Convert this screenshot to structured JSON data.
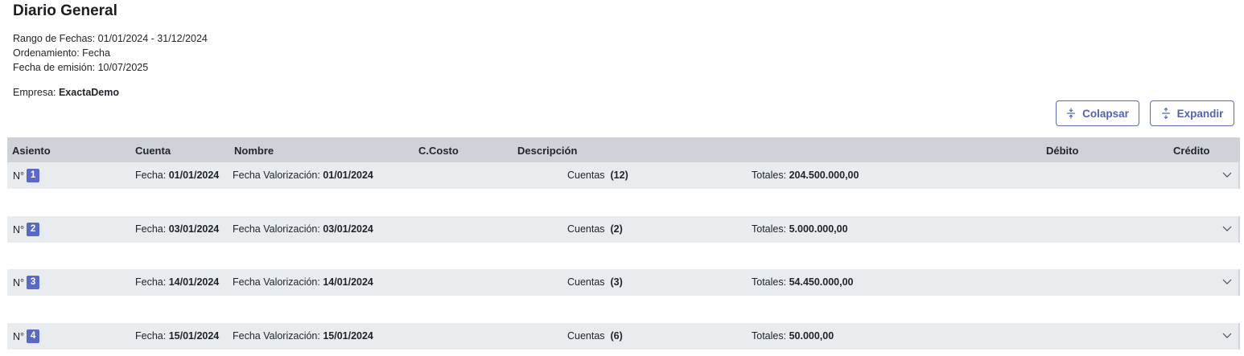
{
  "title": "Diario General",
  "meta": {
    "rango": "Rango de Fechas: 01/01/2024 - 31/12/2024",
    "orden": "Ordenamiento: Fecha",
    "emision": "Fecha de emisión: 10/07/2025",
    "empresa_label": "Empresa: ",
    "empresa_value": "ExactaDemo"
  },
  "buttons": {
    "collapse": "Colapsar",
    "expand": "Expandir"
  },
  "headers": [
    "Asiento",
    "Cuenta",
    "Nombre",
    "C.Costo",
    "Descripción",
    "Débito",
    "Crédito"
  ],
  "labels": {
    "numero": "N°",
    "fecha": "Fecha: ",
    "fecha_valorizacion": "Fecha Valorización: ",
    "cuentas": "Cuentas",
    "totales": "Totales: "
  },
  "rows": [
    {
      "num": "1",
      "fecha": "01/01/2024",
      "valorizacion": "01/01/2024",
      "cuentas": "(12)",
      "totales": "204.500.000,00"
    },
    {
      "num": "2",
      "fecha": "03/01/2024",
      "valorizacion": "03/01/2024",
      "cuentas": "(2)",
      "totales": "5.000.000,00"
    },
    {
      "num": "3",
      "fecha": "14/01/2024",
      "valorizacion": "14/01/2024",
      "cuentas": "(3)",
      "totales": "54.450.000,00"
    },
    {
      "num": "4",
      "fecha": "15/01/2024",
      "valorizacion": "15/01/2024",
      "cuentas": "(6)",
      "totales": "50.000,00"
    }
  ],
  "icons": {
    "collapse": "collapse-icon",
    "expand": "expand-icon",
    "row_toggle": "chevron-down-icon"
  },
  "colors": {
    "accent": "#5869c6",
    "header_bg": "#cfd3d9",
    "row_bg": "#e8ecef"
  }
}
